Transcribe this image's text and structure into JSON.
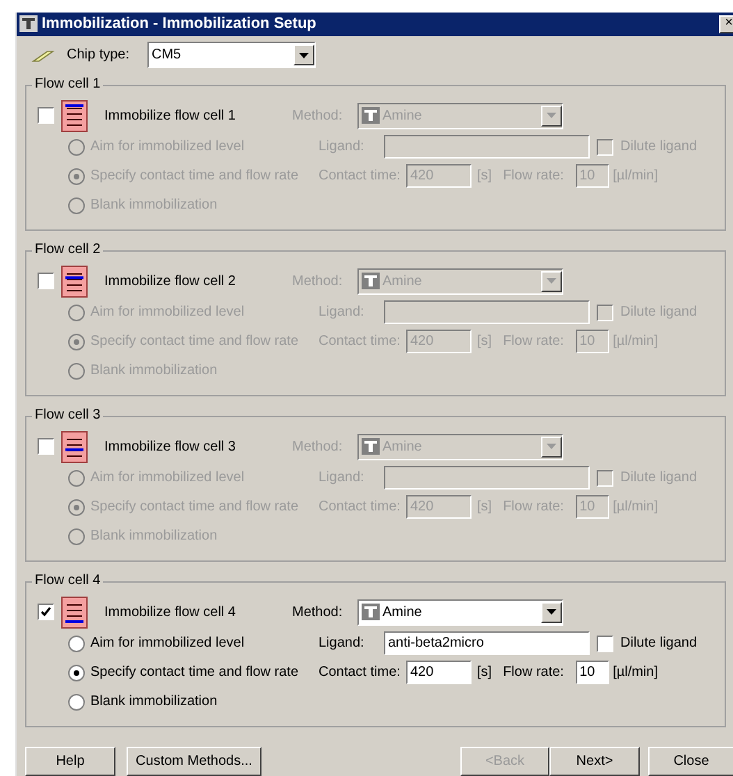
{
  "window": {
    "title": "Immobilization - Immobilization Setup",
    "close": "×"
  },
  "chip": {
    "label": "Chip type:",
    "value": "CM5"
  },
  "flow_cells": [
    {
      "title": "Flow cell 1",
      "checked": false,
      "label": "Immobilize flow cell 1",
      "method_label": "Method:",
      "method": "Amine",
      "ligand_label": "Ligand:",
      "dilute_label": "Dilute ligand",
      "dilute_checked": false,
      "contact_label": "Contact time:",
      "contact_time": "420",
      "contact_unit": "[s]",
      "flow_label": "Flow rate:",
      "flow_rate": "10",
      "flow_unit": "[µl/min]",
      "options": [
        {
          "label": "Aim for immobilized level",
          "selected": false
        },
        {
          "label": "Specify contact time and flow rate",
          "selected": true
        },
        {
          "label": "Blank immobilization",
          "selected": false
        }
      ]
    },
    {
      "title": "Flow cell 2",
      "checked": false,
      "label": "Immobilize flow cell 2",
      "method_label": "Method:",
      "method": "Amine",
      "ligand_label": "Ligand:",
      "dilute_label": "Dilute ligand",
      "dilute_checked": false,
      "contact_label": "Contact time:",
      "contact_time": "420",
      "contact_unit": "[s]",
      "flow_label": "Flow rate:",
      "flow_rate": "10",
      "flow_unit": "[µl/min]",
      "options": [
        {
          "label": "Aim for immobilized level",
          "selected": false
        },
        {
          "label": "Specify contact time and flow rate",
          "selected": true
        },
        {
          "label": "Blank immobilization",
          "selected": false
        }
      ]
    },
    {
      "title": "Flow cell 3",
      "checked": false,
      "label": "Immobilize flow cell 3",
      "method_label": "Method:",
      "method": "Amine",
      "ligand_label": "Ligand:",
      "dilute_label": "Dilute ligand",
      "dilute_checked": false,
      "contact_label": "Contact time:",
      "contact_time": "420",
      "contact_unit": "[s]",
      "flow_label": "Flow rate:",
      "flow_rate": "10",
      "flow_unit": "[µl/min]",
      "options": [
        {
          "label": "Aim for immobilized level",
          "selected": false
        },
        {
          "label": "Specify contact time and flow rate",
          "selected": true
        },
        {
          "label": "Blank immobilization",
          "selected": false
        }
      ]
    },
    {
      "title": "Flow cell 4",
      "checked": true,
      "label": "Immobilize flow cell 4",
      "method_label": "Method:",
      "method": "Amine",
      "ligand_label": "Ligand:",
      "ligand": "anti-beta2micro",
      "dilute_label": "Dilute ligand",
      "dilute_checked": false,
      "contact_label": "Contact time:",
      "contact_time": "420",
      "contact_unit": "[s]",
      "flow_label": "Flow rate:",
      "flow_rate": "10",
      "flow_unit": "[µl/min]",
      "options": [
        {
          "label": "Aim for immobilized level",
          "selected": false
        },
        {
          "label": "Specify contact time and flow rate",
          "selected": true
        },
        {
          "label": "Blank immobilization",
          "selected": false
        }
      ]
    }
  ],
  "buttons": [
    {
      "label": "Help",
      "disabled": false
    },
    {
      "label": "Custom Methods...",
      "disabled": false
    },
    {
      "label": "<Back",
      "disabled": true
    },
    {
      "label": "Next>",
      "disabled": false
    },
    {
      "label": "Close",
      "disabled": false
    }
  ]
}
